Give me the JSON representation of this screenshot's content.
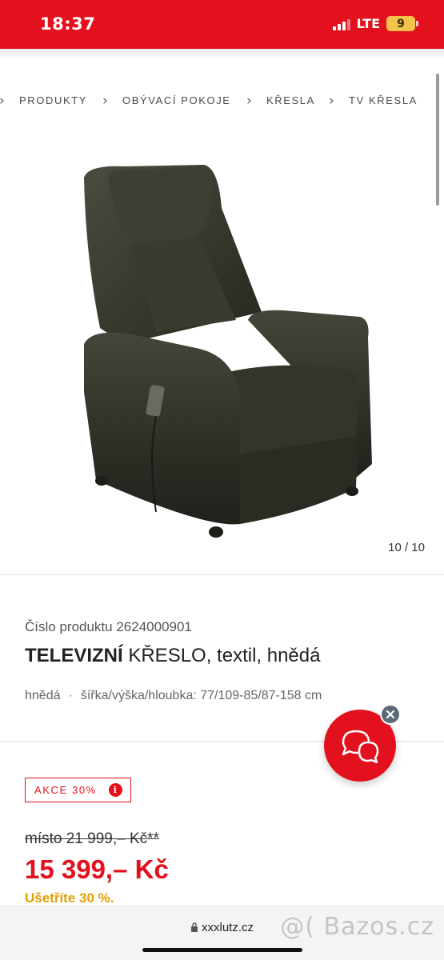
{
  "status_bar": {
    "time": "18:37",
    "network": "LTE",
    "battery": "9"
  },
  "breadcrumb": {
    "items": [
      "PRODUKTY",
      "OBÝVACÍ POKOJE",
      "KŘESLA",
      "TV KŘESLA"
    ]
  },
  "gallery": {
    "counter": "10 / 10"
  },
  "product": {
    "number": "Číslo produktu 2624000901",
    "title_bold": "TELEVIZNÍ",
    "title_rest": " KŘESLO, textil, hnědá",
    "color": "hnědá",
    "dot": "·",
    "dimensions": "šířka/výška/hloubka: 77/109-85/87-158 cm"
  },
  "price": {
    "badge": "AKCE 30%",
    "badge_info": "i",
    "old": "místo 21 999,– Kč**",
    "new": "15 399,– Kč",
    "savings": "Ušetříte 30 %."
  },
  "browser": {
    "url": "xxxlutz.cz"
  },
  "watermark": "@( Bazos.cz",
  "colors": {
    "brand_red": "#e3101d",
    "savings_yellow": "#e0a000"
  },
  "icons": [
    "signal-icon",
    "battery-icon",
    "chevron-right-icon",
    "chat-icon",
    "close-icon",
    "info-icon",
    "lock-icon"
  ]
}
